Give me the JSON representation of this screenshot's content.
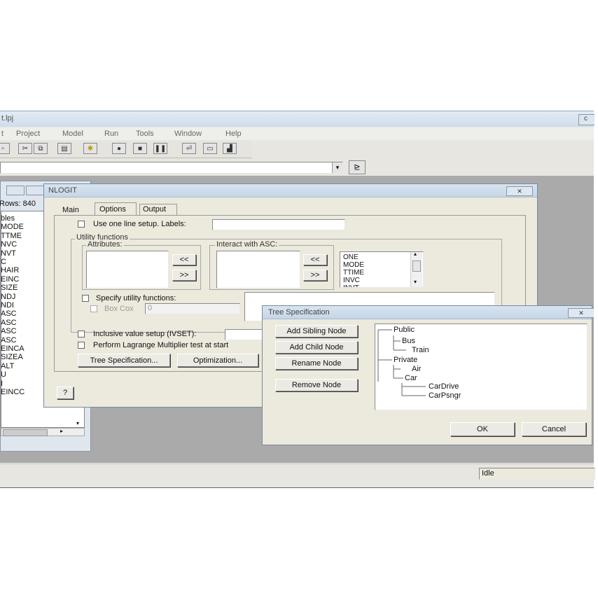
{
  "app": {
    "title": "t.lpj",
    "menu": [
      "t",
      "Project",
      "Model",
      "Run",
      "Tools",
      "Window",
      "Help"
    ],
    "title_right_button": "c",
    "status_text": "Idle"
  },
  "toolbar": {
    "icons": [
      "new-icon",
      "cut-icon",
      "copy-icon",
      "paste-icon",
      "star-icon",
      "record-icon",
      "stop-icon",
      "pause-icon",
      "run-icon",
      "window-icon",
      "chart-icon"
    ]
  },
  "command_bar": {
    "dropdown_arrow": "▾",
    "go_label": "⊵"
  },
  "data_window": {
    "rows_label": "Rows: 840",
    "variables": [
      "bles",
      "MODE",
      "TTME",
      "NVC",
      "NVT",
      "C",
      "HAIR",
      "EINC",
      "SIZE",
      "NDJ",
      "NDI",
      "ASC",
      "ASC",
      "ASC",
      "ASC",
      "EINCA",
      "SIZEA",
      "ALT",
      "U",
      "I",
      "EINCC"
    ]
  },
  "nlogit_dialog": {
    "title": "NLOGIT",
    "close_label": "✕",
    "tabs": [
      "Main",
      "Options",
      "Output"
    ],
    "use_one_line": "Use one line setup. Labels:",
    "utility_functions_label": "Utility functions",
    "attributes_label": "Attributes:",
    "interact_label": "Interact with ASC:",
    "move_left": "<<",
    "move_right": ">>",
    "list_items": [
      "ONE",
      "MODE",
      "TTIME",
      "INVC",
      "INVT"
    ],
    "specify_utility": "Specify utility functions:",
    "box_cox": "Box Cox",
    "box_cox_value": "0",
    "inclusive_value": "Inclusive value setup (IVSET):",
    "perform_lagrange": "Perform Lagrange Multiplier test at start",
    "tree_spec_button": "Tree Specification...",
    "optimization_button": "Optimization...",
    "help_button": "?"
  },
  "tree_dialog": {
    "title": "Tree Specification",
    "close_label": "✕",
    "add_sibling": "Add Sibling Node",
    "add_child": "Add Child Node",
    "rename": "Rename Node",
    "remove": "Remove Node",
    "ok": "OK",
    "cancel": "Cancel",
    "tree": {
      "public": "Public",
      "bus": "Bus",
      "train": "Train",
      "private": "Private",
      "air": "Air",
      "car": "Car",
      "cardrive": "CarDrive",
      "carpsngr": "CarPsngr"
    }
  }
}
